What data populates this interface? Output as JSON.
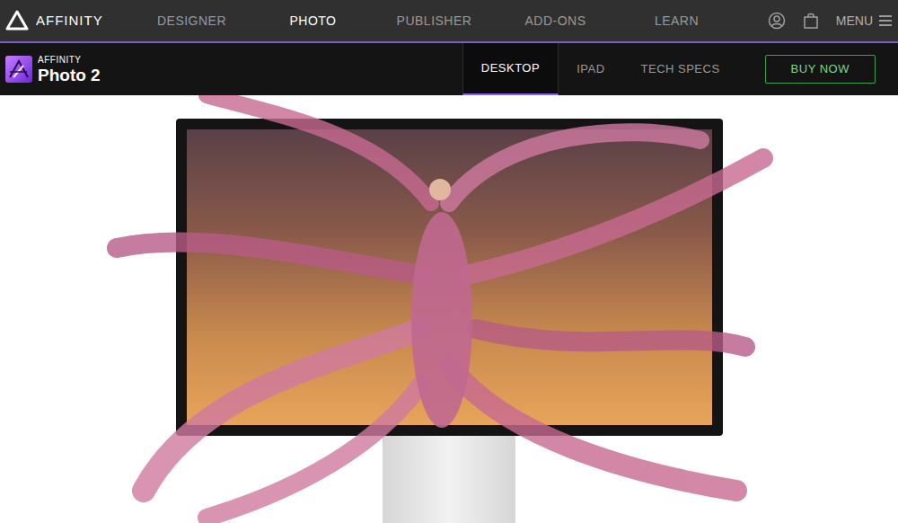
{
  "brand": {
    "name": "AFFINITY"
  },
  "nav": {
    "items": [
      {
        "label": "DESIGNER",
        "selected": false
      },
      {
        "label": "PHOTO",
        "selected": true
      },
      {
        "label": "PUBLISHER",
        "selected": false
      },
      {
        "label": "ADD-ONS",
        "selected": false
      },
      {
        "label": "LEARN",
        "selected": false
      }
    ],
    "menu": "MENU"
  },
  "product": {
    "brand": "AFFINITY",
    "name": "Photo 2"
  },
  "subnav": {
    "items": [
      {
        "label": "DESKTOP",
        "selected": true
      },
      {
        "label": "IPAD",
        "selected": false
      },
      {
        "label": "TECH SPECS",
        "selected": false
      }
    ],
    "cta": "BUY NOW"
  }
}
